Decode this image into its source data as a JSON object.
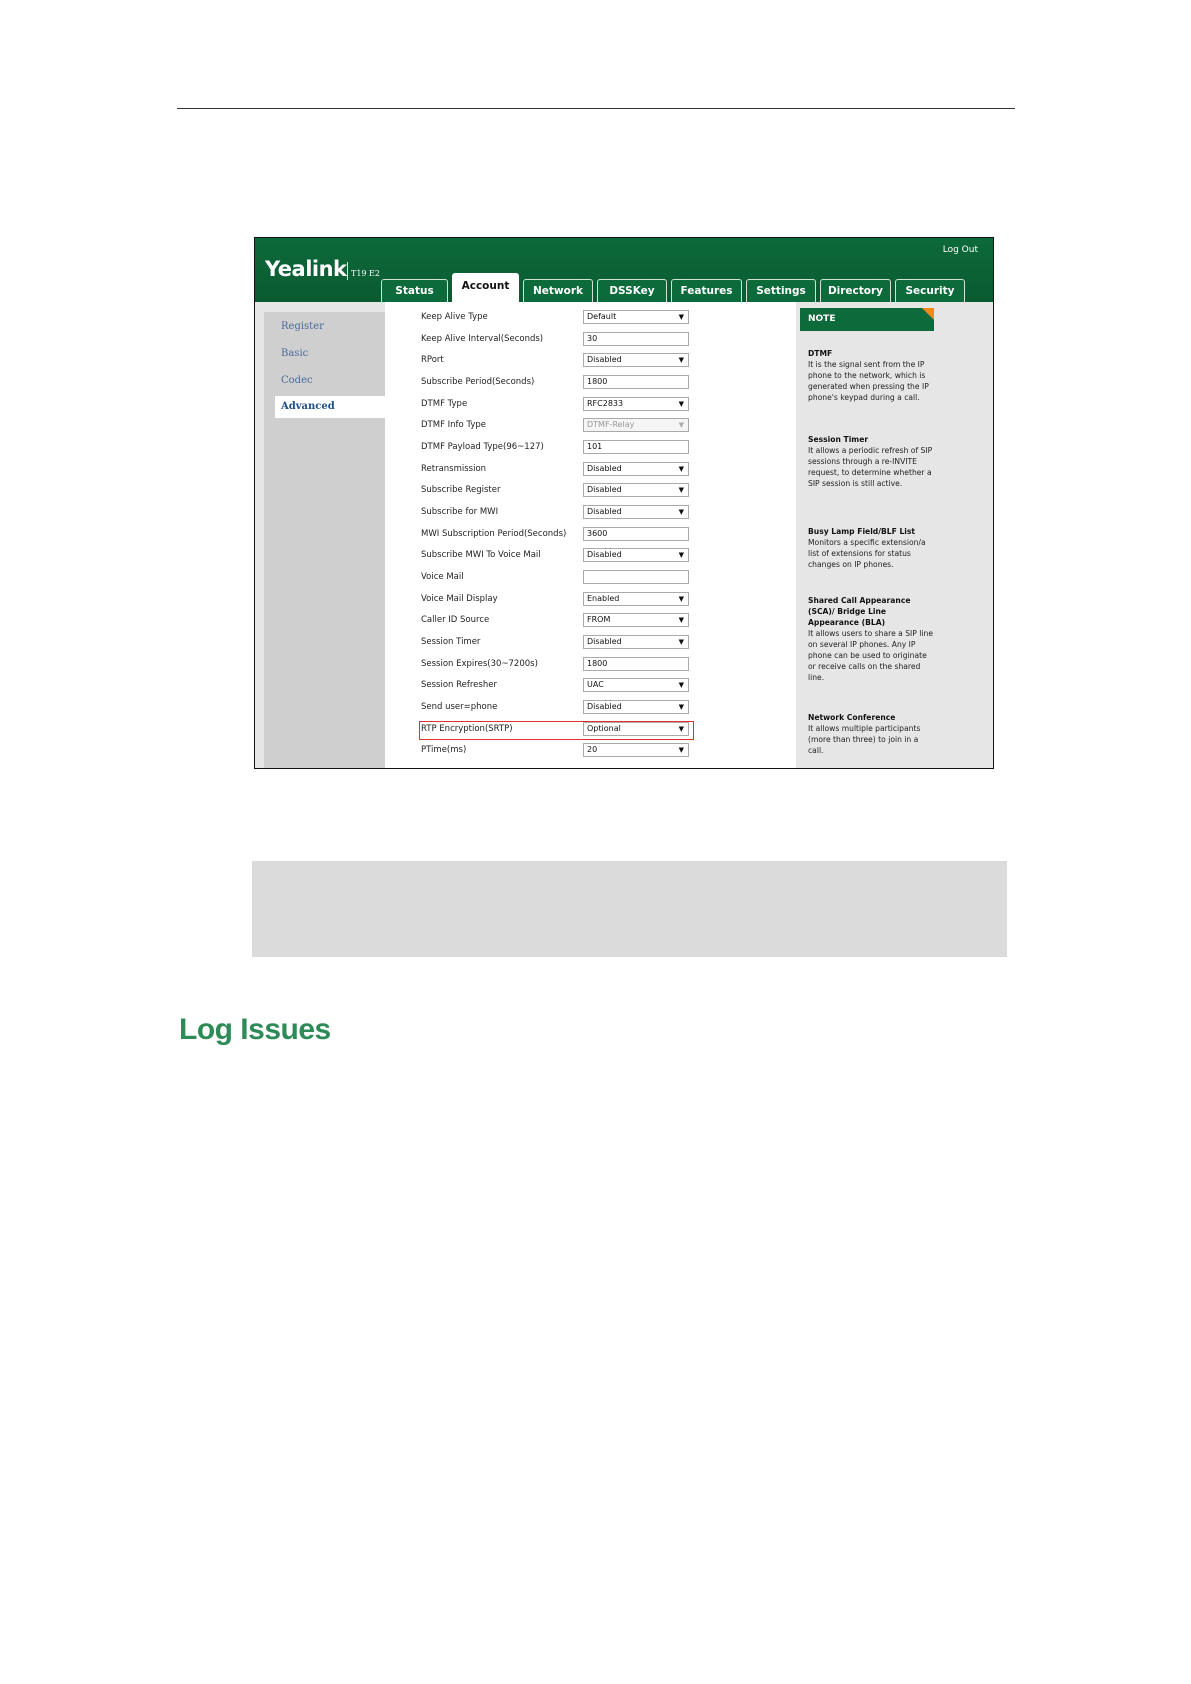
{
  "header": {
    "logo": "Yealink",
    "model": "T19 E2",
    "logout": "Log Out",
    "tabs": [
      "Status",
      "Account",
      "Network",
      "DSSKey",
      "Features",
      "Settings",
      "Directory",
      "Security"
    ],
    "active_tab": "Account"
  },
  "sidebar": {
    "items": [
      "Register",
      "Basic",
      "Codec",
      "Advanced"
    ],
    "active": "Advanced"
  },
  "form": {
    "rows": [
      {
        "label": "Keep Alive Type",
        "value": "Default"
      },
      {
        "label": "Keep Alive Interval(Seconds)",
        "value": "30"
      },
      {
        "label": "RPort",
        "value": "Disabled"
      },
      {
        "label": "Subscribe Period(Seconds)",
        "value": "1800"
      },
      {
        "label": "DTMF Type",
        "value": "RFC2833"
      },
      {
        "label": "DTMF Info Type",
        "value": "DTMF-Relay"
      },
      {
        "label": "DTMF Payload Type(96~127)",
        "value": "101"
      },
      {
        "label": "Retransmission",
        "value": "Disabled"
      },
      {
        "label": "Subscribe Register",
        "value": "Disabled"
      },
      {
        "label": "Subscribe for MWI",
        "value": "Disabled"
      },
      {
        "label": "MWI Subscription Period(Seconds)",
        "value": "3600"
      },
      {
        "label": "Subscribe MWI To Voice Mail",
        "value": "Disabled"
      },
      {
        "label": "Voice Mail",
        "value": ""
      },
      {
        "label": "Voice Mail Display",
        "value": "Enabled"
      },
      {
        "label": "Caller ID Source",
        "value": "FROM"
      },
      {
        "label": "Session Timer",
        "value": "Disabled"
      },
      {
        "label": "Session Expires(30~7200s)",
        "value": "1800"
      },
      {
        "label": "Session Refresher",
        "value": "UAC"
      },
      {
        "label": "Send user=phone",
        "value": "Disabled"
      },
      {
        "label": "RTP Encryption(SRTP)",
        "value": "Optional"
      },
      {
        "label": "PTime(ms)",
        "value": "20"
      }
    ]
  },
  "note": {
    "title": "NOTE",
    "sections": [
      {
        "title": "DTMF",
        "text": "It is the signal sent from the IP phone to the network, which is generated when pressing the IP phone's keypad during a call."
      },
      {
        "title": "Session Timer",
        "text": "It allows a periodic refresh of SIP sessions through a re-INVITE request, to determine whether a SIP session is still active."
      },
      {
        "title": "Busy Lamp Field/BLF List",
        "text": "Monitors a specific extension/a list of extensions for status changes on IP phones."
      },
      {
        "title": "Shared Call Appearance (SCA)/ Bridge Line Appearance (BLA)",
        "text": "It allows users to share a SIP line on several IP phones. Any IP phone can be used to originate or receive calls on the shared line."
      },
      {
        "title": "Network Conference",
        "text": "It allows multiple participants (more than three) to join in a call."
      }
    ]
  },
  "doc": {
    "heading": "Log Issues"
  },
  "colors": {
    "brand": "#0d6a3a",
    "heading": "#2e8b57",
    "highlight": "#e03030"
  }
}
